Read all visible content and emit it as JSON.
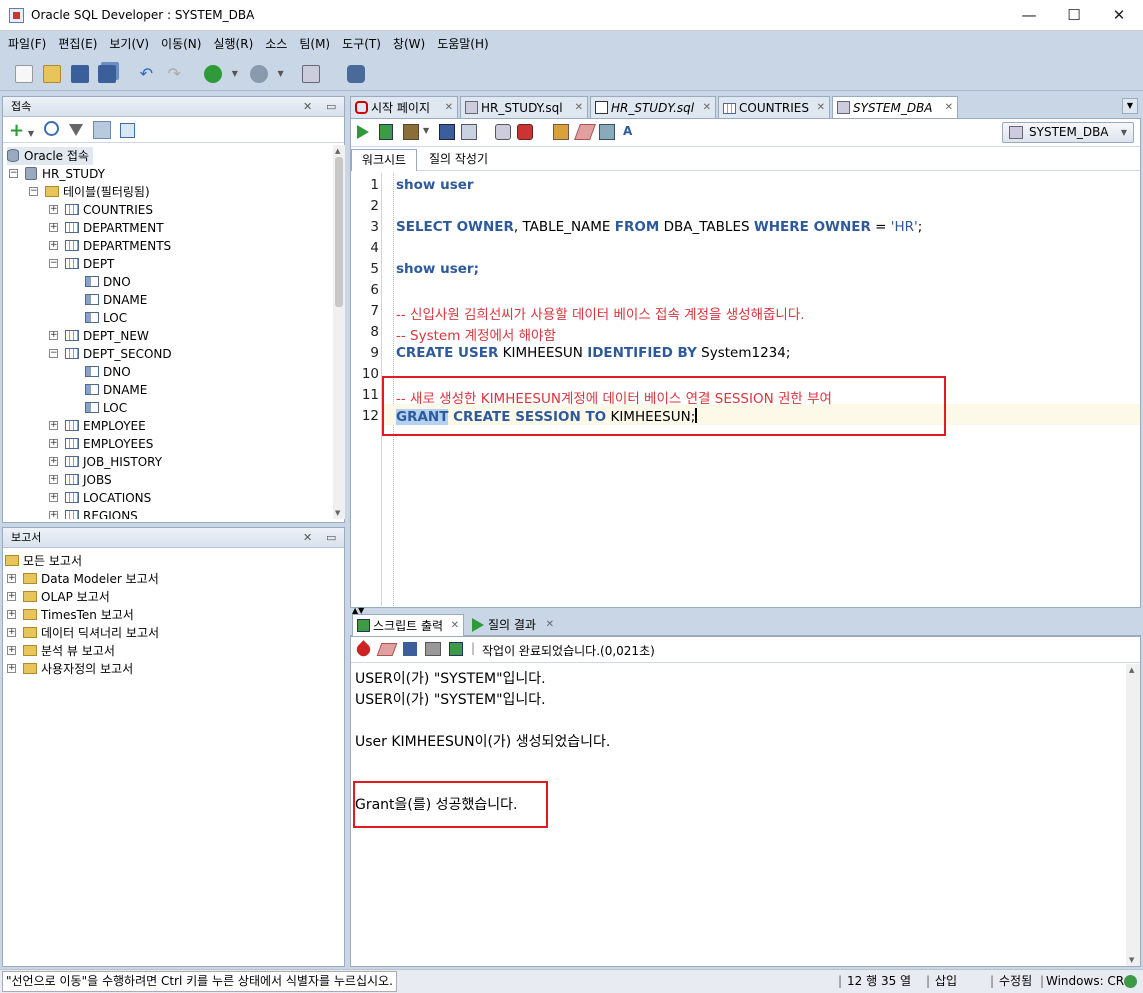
{
  "window": {
    "title": "Oracle SQL Developer : SYSTEM_DBA",
    "minimize": "—",
    "maximize": "☐",
    "close": "✕"
  },
  "menu": [
    "파일(F)",
    "편집(E)",
    "보기(V)",
    "이동(N)",
    "실행(R)",
    "소스",
    "팀(M)",
    "도구(T)",
    "창(W)",
    "도움말(H)"
  ],
  "connections_panel": {
    "title": "접속",
    "root": "Oracle 접속",
    "connection": "HR_STUDY",
    "tables_folder": "테이블(필터링됨)",
    "items": [
      {
        "label": "COUNTRIES",
        "kind": "table",
        "expanded": false
      },
      {
        "label": "DEPARTMENT",
        "kind": "table",
        "expanded": false
      },
      {
        "label": "DEPARTMENTS",
        "kind": "table",
        "expanded": false
      },
      {
        "label": "DEPT",
        "kind": "table",
        "expanded": true
      },
      {
        "label": "DNO",
        "kind": "column"
      },
      {
        "label": "DNAME",
        "kind": "column"
      },
      {
        "label": "LOC",
        "kind": "column"
      },
      {
        "label": "DEPT_NEW",
        "kind": "table",
        "expanded": false
      },
      {
        "label": "DEPT_SECOND",
        "kind": "table",
        "expanded": true
      },
      {
        "label": "DNO",
        "kind": "column"
      },
      {
        "label": "DNAME",
        "kind": "column"
      },
      {
        "label": "LOC",
        "kind": "column"
      },
      {
        "label": "EMPLOYEE",
        "kind": "table",
        "expanded": false
      },
      {
        "label": "EMPLOYEES",
        "kind": "table",
        "expanded": false
      },
      {
        "label": "JOB_HISTORY",
        "kind": "table",
        "expanded": false
      },
      {
        "label": "JOBS",
        "kind": "table",
        "expanded": false
      },
      {
        "label": "LOCATIONS",
        "kind": "table",
        "expanded": false
      },
      {
        "label": "REGIONS",
        "kind": "table",
        "expanded": false
      }
    ]
  },
  "reports_panel": {
    "title": "보고서",
    "root": "모든 보고서",
    "items": [
      "Data Modeler 보고서",
      "OLAP 보고서",
      "TimesTen 보고서",
      "데이터 딕셔너리 보고서",
      "분석 뷰 보고서",
      "사용자정의 보고서"
    ]
  },
  "editor_tabs": [
    {
      "label": "시작 페이지",
      "active": false
    },
    {
      "label": "HR_STUDY.sql",
      "active": false
    },
    {
      "label": "HR_STUDY.sql",
      "active": false
    },
    {
      "label": "COUNTRIES",
      "active": false
    },
    {
      "label": "SYSTEM_DBA",
      "active": true
    }
  ],
  "connection_selector": "SYSTEM_DBA",
  "subtabs": [
    "워크시트",
    "질의 작성기"
  ],
  "code_lines": [
    [
      {
        "t": "show user",
        "c": "kw"
      }
    ],
    [],
    [
      {
        "t": "SELECT OWNER",
        "c": "kw"
      },
      {
        "t": ", TABLE_NAME ",
        "c": ""
      },
      {
        "t": "FROM",
        "c": "kw"
      },
      {
        "t": " DBA_TABLES ",
        "c": ""
      },
      {
        "t": "WHERE OWNER",
        "c": "kw"
      },
      {
        "t": " = ",
        "c": ""
      },
      {
        "t": "'HR'",
        "c": "str"
      },
      {
        "t": ";",
        "c": ""
      }
    ],
    [],
    [
      {
        "t": "show user",
        "c": "kw"
      },
      {
        "t": ";",
        "c": "kw"
      }
    ],
    [],
    [
      {
        "t": "-- 신입사원 김희선씨가 사용할 데이터 베이스 접속 계정을 생성해줍니다.",
        "c": "cm"
      }
    ],
    [
      {
        "t": "-- System 계정에서 해야함",
        "c": "cm"
      }
    ],
    [
      {
        "t": "CREATE USER",
        "c": "kw"
      },
      {
        "t": " KIMHEESUN ",
        "c": ""
      },
      {
        "t": "IDENTIFIED BY",
        "c": "kw"
      },
      {
        "t": " System1234;",
        "c": ""
      }
    ],
    [],
    [
      {
        "t": "-- 새로 생성한 KIMHEESUN계정에 데이터 베이스 연결 SESSION 권한 부여",
        "c": "cm"
      }
    ],
    [
      {
        "t": "GRANT",
        "c": "kw sel"
      },
      {
        "t": " CREATE SESSION TO",
        "c": "kw"
      },
      {
        "t": " KIMHEESUN;",
        "c": ""
      }
    ]
  ],
  "output_tabs": [
    "스크립트 출력",
    "질의 결과"
  ],
  "output_status": "작업이 완료되었습니다.(0,021초)",
  "output_lines": [
    "USER이(가) \"SYSTEM\"입니다.",
    "USER이(가) \"SYSTEM\"입니다.",
    "",
    "User KIMHEESUN이(가) 생성되었습니다.",
    "",
    "",
    "Grant을(를) 성공했습니다."
  ],
  "statusbar": {
    "message": "\"선언으로 이동\"을 수행하려면 Ctrl 키를 누른 상태에서 식별자를 누르십시오.",
    "position": "12 행 35 열",
    "mode": "삽입",
    "modified": "수정됨",
    "platform": "Windows: CR"
  },
  "colors": {
    "keyword": "#2e5a9c",
    "comment": "#d9363e",
    "highlight_box": "#e01b24",
    "chrome": "#c9d6e5"
  }
}
